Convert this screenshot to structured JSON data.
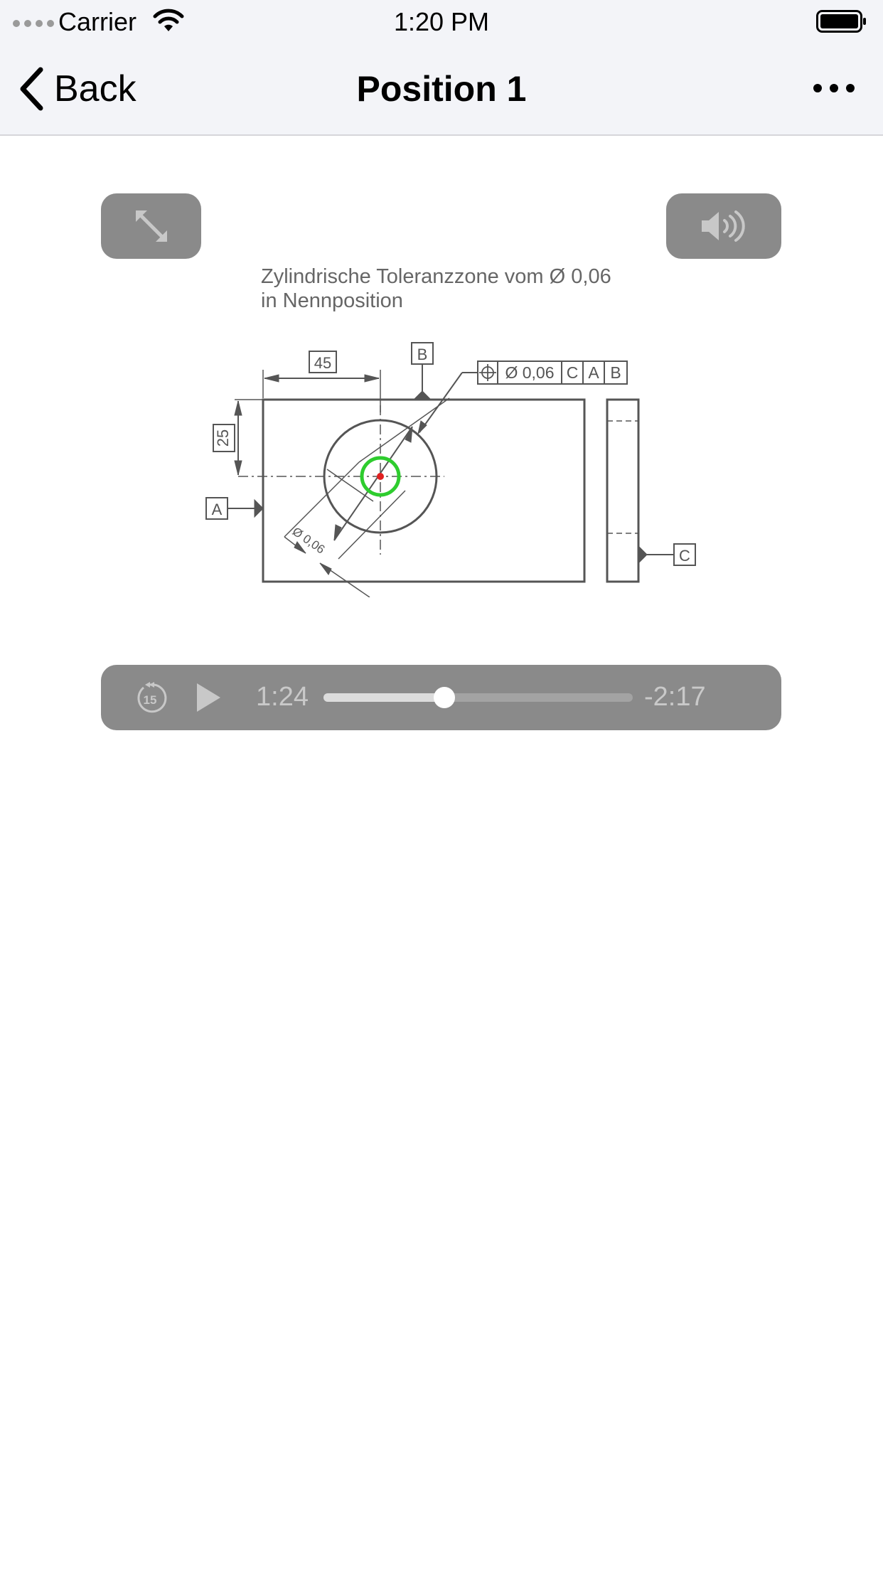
{
  "status_bar": {
    "carrier": "Carrier",
    "time": "1:20 PM"
  },
  "nav": {
    "back_label": "Back",
    "title": "Position 1"
  },
  "toolbar": {
    "expand_icon": "expand-arrows-icon",
    "sound_icon": "speaker-icon"
  },
  "drawing": {
    "caption_line1": "Zylindrische Toleranzzone vom Ø 0,06",
    "caption_line2": "in Nennposition",
    "dim_horizontal": "45",
    "dim_vertical": "25",
    "datum_a": "A",
    "datum_b": "B",
    "datum_c": "C",
    "frame_tolerance": "Ø 0,06",
    "frame_ref1": "C",
    "frame_ref2": "A",
    "frame_ref3": "B",
    "zone_label": "Ø 0,06"
  },
  "player": {
    "skip_back_seconds": "15",
    "elapsed": "1:24",
    "remaining": "-2:17",
    "progress": 0.39
  },
  "colors": {
    "control_bg": "#8a8a8a",
    "tolerance_zone": "#2ecc2e",
    "center_point": "#e02020"
  }
}
